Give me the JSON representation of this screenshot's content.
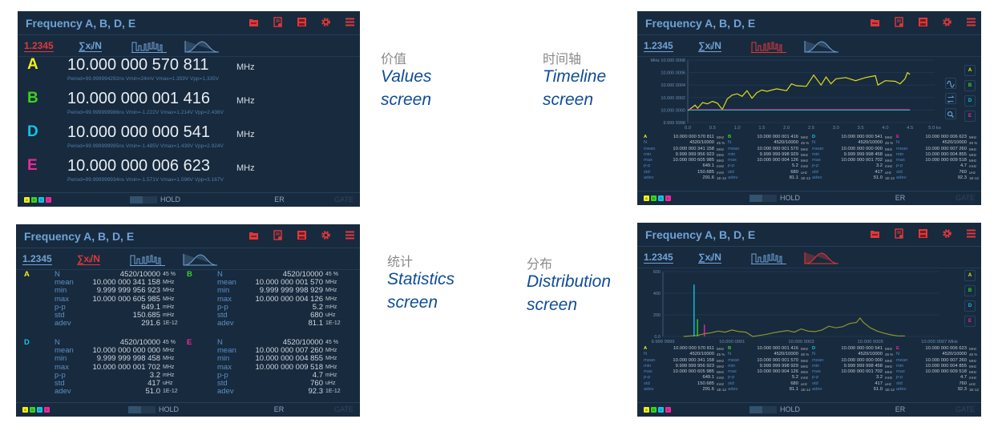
{
  "window_title": "Frequency A, B, D, E",
  "toolbar": {
    "values_mode": "1.2345",
    "stats_mode": "∑xᵢ/N",
    "timeline_mode": "timeline-icon",
    "distribution_mode": "distribution-icon"
  },
  "header_icons": [
    "folder-icon",
    "save-settings-icon",
    "save-screenshot-icon",
    "gear-icon",
    "menu-icon"
  ],
  "footer": {
    "hold": "HOLD",
    "er": "ER",
    "gate": "GATE"
  },
  "colors": {
    "A": "#f2ef1a",
    "B": "#35d622",
    "D": "#14c4e4",
    "E": "#f0289e",
    "accent": "#e0383a",
    "title": "#6fa3d6",
    "background": "#182a3e"
  },
  "channels": [
    {
      "id": "A",
      "value": "10.000 000 570 811",
      "unit": "MHz",
      "detail": "Period=99.999994292ns Vmin=24mV Vmax=1.359V Vpp=1.335V",
      "stats": [
        [
          "N",
          "4520/10000",
          "45 %"
        ],
        [
          "mean",
          "10.000 000 341 158",
          "MHz"
        ],
        [
          "min",
          "9.999 999 956 923",
          "MHz"
        ],
        [
          "max",
          "10.000 000 605 985",
          "MHz"
        ],
        [
          "p-p",
          "649.1",
          "mHz"
        ],
        [
          "std",
          "150.685",
          "mHz"
        ],
        [
          "adev",
          "291.6",
          "1E-12"
        ]
      ]
    },
    {
      "id": "B",
      "value": "10.000 000 001 416",
      "unit": "MHz",
      "detail": "Period=99.999999986ns Vmin=-1.222V Vmax=1.214V Vpp=2.436V",
      "stats": [
        [
          "N",
          "4520/10000",
          "45 %"
        ],
        [
          "mean",
          "10.000 000 001 570",
          "MHz"
        ],
        [
          "min",
          "9.999 999 998 929",
          "MHz"
        ],
        [
          "max",
          "10.000 000 004 126",
          "MHz"
        ],
        [
          "p-p",
          "5.2",
          "mHz"
        ],
        [
          "std",
          "680",
          "uHz"
        ],
        [
          "adev",
          "81.1",
          "1E-12"
        ]
      ]
    },
    {
      "id": "D",
      "value": "10.000 000 000 541",
      "unit": "MHz",
      "detail": "Period=99.999999995ns Vmin=-1.485V Vmax=1.439V Vpp=2.924V",
      "stats": [
        [
          "N",
          "4520/10000",
          "45 %"
        ],
        [
          "mean",
          "10.000 000 000 000",
          "MHz"
        ],
        [
          "min",
          "9.999 999 998 458",
          "MHz"
        ],
        [
          "max",
          "10.000 000 001 702",
          "MHz"
        ],
        [
          "p-p",
          "3.2",
          "mHz"
        ],
        [
          "std",
          "417",
          "uHz"
        ],
        [
          "adev",
          "51.0",
          "1E-12"
        ]
      ]
    },
    {
      "id": "E",
      "value": "10.000 000 006 623",
      "unit": "MHz",
      "detail": "Period=99.999999934ns Vmin=-1.571V Vmax=1.596V Vpp=3.167V",
      "stats": [
        [
          "N",
          "4520/10000",
          "45 %"
        ],
        [
          "mean",
          "10.000 000 007 260",
          "MHz"
        ],
        [
          "min",
          "10.000 000 004 855",
          "MHz"
        ],
        [
          "max",
          "10.000 000 009 518",
          "MHz"
        ],
        [
          "p-p",
          "4.7",
          "mHz"
        ],
        [
          "std",
          "760",
          "uHz"
        ],
        [
          "adev",
          "92.3",
          "1E-12"
        ]
      ]
    }
  ],
  "captions": [
    {
      "cn": "价值",
      "en1": "Values",
      "en2": "screen"
    },
    {
      "cn": "时间轴",
      "en1": "Timeline",
      "en2": "screen"
    },
    {
      "cn": "统计",
      "en1": "Statistics",
      "en2": "screen"
    },
    {
      "cn": "分布",
      "en1": "Distribution",
      "en2": "screen"
    }
  ],
  "chart_data": [
    {
      "type": "line",
      "unit_y": "MHz",
      "unit_x": "ks",
      "ylim": [
        9.9999998,
        10.0000008
      ],
      "xlim": [
        0,
        5
      ],
      "y_ticks": [
        "9.999 9998",
        "10.000 0000",
        "10.000 0002",
        "10.000 0004",
        "10.000 0006",
        "10.000 0008"
      ],
      "y_tick_values": [
        9.9999998,
        10.0,
        10.0000002,
        10.0000004,
        10.0000006,
        10.0000008
      ],
      "x_ticks": [
        "0.0",
        "0.5",
        "1.0",
        "1.5",
        "2.0",
        "2.5",
        "3.0",
        "3.5",
        "4.0",
        "4.5",
        "5.0 ks"
      ],
      "x_tick_values": [
        0,
        0.5,
        1,
        1.5,
        2,
        2.5,
        3,
        3.5,
        4,
        4.5,
        5
      ],
      "series": [
        {
          "channel": "A",
          "x": [
            0,
            0.1,
            0.15,
            0.2,
            0.3,
            0.4,
            0.5,
            0.6,
            0.7,
            0.8,
            0.9,
            1.0,
            1.1,
            1.2,
            1.3,
            1.4,
            1.5,
            1.6,
            1.8,
            2.0,
            2.1,
            2.2,
            2.4,
            2.5,
            2.55,
            2.7,
            2.8,
            2.9,
            3.0,
            3.2,
            3.4,
            3.6,
            3.8,
            3.85,
            4.0,
            4.2,
            4.3,
            4.4,
            4.45,
            4.5
          ],
          "y": [
            9.99999999,
            10.00000005,
            10.00000008,
            10.00000003,
            10.00000012,
            10.0000001,
            10.00000014,
            10.00000011,
            10.00000001,
            10.00000018,
            10.00000024,
            10.00000026,
            10.00000022,
            10.00000031,
            10.00000019,
            10.00000028,
            10.00000032,
            10.0000003,
            10.00000034,
            10.00000031,
            10.00000042,
            10.00000039,
            10.00000038,
            10.0000005,
            10.00000056,
            10.0000004,
            10.00000053,
            10.00000042,
            10.0000005,
            10.00000052,
            10.00000047,
            10.00000052,
            10.00000055,
            10.0000004,
            10.00000047,
            10.00000046,
            10.00000042,
            10.0000005,
            10.0000006,
            10.00000057
          ]
        },
        {
          "channel": "B",
          "x": [
            0,
            4.5
          ],
          "y": [
            10.0,
            10.0
          ]
        },
        {
          "channel": "D",
          "x": [
            0,
            4.5
          ],
          "y": [
            10.0,
            10.0
          ]
        },
        {
          "channel": "E",
          "x": [
            0,
            4.5
          ],
          "y": [
            10.00000001,
            10.00000001
          ]
        }
      ]
    },
    {
      "type": "line",
      "unit_x": "MHz",
      "ylim": [
        0,
        600
      ],
      "xlim": [
        9.9999999,
        10.0000007
      ],
      "y_ticks": [
        "0.0",
        "200",
        "400",
        "600"
      ],
      "y_tick_values": [
        0,
        200,
        400,
        600
      ],
      "x_ticks": [
        "9.999 9999",
        "10.000 0001",
        "10.000 0003",
        "10.000 0005",
        "10.000 0007 MHz"
      ],
      "x_tick_values": [
        9.9999999,
        10.0000001,
        10.0000003,
        10.0000005,
        10.0000007
      ],
      "series": [
        {
          "channel": "A",
          "x": [
            9.99999996,
            9.99999998,
            10.0,
            10.00000002,
            10.00000004,
            10.00000006,
            10.00000008,
            10.0000001,
            10.00000012,
            10.00000014,
            10.00000016,
            10.00000018,
            10.0000002,
            10.00000022,
            10.00000024,
            10.00000026,
            10.00000028,
            10.0000003,
            10.00000032,
            10.00000034,
            10.00000036,
            10.00000038,
            10.0000004,
            10.00000042,
            10.00000044,
            10.00000046,
            10.00000047,
            10.00000048,
            10.0000005,
            10.00000052,
            10.00000054,
            10.00000056,
            10.00000058,
            10.0000006
          ],
          "y": [
            0,
            5,
            10,
            25,
            35,
            50,
            40,
            60,
            45,
            40,
            0,
            10,
            20,
            35,
            45,
            55,
            40,
            70,
            50,
            45,
            60,
            95,
            80,
            90,
            120,
            130,
            170,
            130,
            80,
            50,
            30,
            15,
            5,
            5
          ]
        },
        {
          "channel": "B",
          "x": [
            10.0
          ],
          "y": [
            160
          ],
          "bars": true
        },
        {
          "channel": "D",
          "x": [
            9.99999999
          ],
          "y": [
            480
          ],
          "bars": true
        },
        {
          "channel": "E",
          "x": [
            10.00000002
          ],
          "y": [
            110
          ],
          "bars": true
        }
      ]
    }
  ]
}
